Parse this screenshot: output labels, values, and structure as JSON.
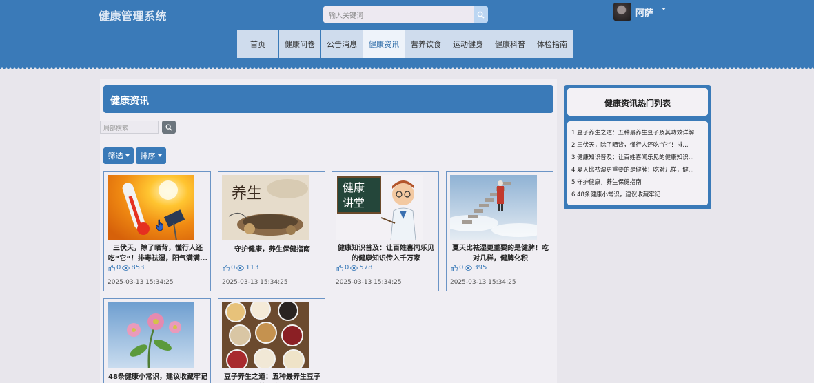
{
  "header": {
    "site_title": "健康管理系统",
    "search_placeholder": "输入关键词",
    "search_icon": "search-icon",
    "user_name": "阿萨"
  },
  "nav": [
    {
      "label": "首页",
      "active": false
    },
    {
      "label": "健康问卷",
      "active": false
    },
    {
      "label": "公告消息",
      "active": false
    },
    {
      "label": "健康资讯",
      "active": true
    },
    {
      "label": "营养饮食",
      "active": false
    },
    {
      "label": "运动健身",
      "active": false
    },
    {
      "label": "健康科普",
      "active": false
    },
    {
      "label": "体检指南",
      "active": false
    }
  ],
  "main": {
    "title": "健康资讯",
    "local_search_placeholder": "局部搜索",
    "filter_label": "筛选",
    "sort_label": "排序",
    "cards": [
      {
        "title": "三伏天，除了晒背，懂行人还吃“它”！排毒祛湿，阳气满满...",
        "likes": "0",
        "views": "853",
        "date": "2025-03-13 15:34:25",
        "image": "thermometer-sun"
      },
      {
        "title": "守护健康，养生保健指南",
        "likes": "0",
        "views": "113",
        "date": "2025-03-13 15:34:25",
        "image": "yangsheng-herbs"
      },
      {
        "title": "健康知识普及：让百姓喜闻乐见的健康知识传入千万家",
        "likes": "0",
        "views": "578",
        "date": "2025-03-13 15:34:25",
        "image": "health-lecture"
      },
      {
        "title": "夏天比祛湿更重要的是健脾！吃对几样，健脾化积",
        "likes": "0",
        "views": "395",
        "date": "2025-03-13 15:34:25",
        "image": "stairs-sky"
      },
      {
        "title": "48条健康小常识，建议收藏牢记",
        "likes": "",
        "views": "",
        "date": "",
        "image": "flower-sky"
      },
      {
        "title": "豆子养生之道：五种最养生豆子及其功效详解",
        "likes": "",
        "views": "",
        "date": "",
        "image": "beans-bowls"
      }
    ],
    "chalkboard_text": [
      "健康",
      "讲堂"
    ],
    "yangsheng_text": "养生"
  },
  "sidebar": {
    "title": "健康资讯热门列表",
    "items": [
      "1  豆子养生之道：五种最养生豆子及其功效详解",
      "2  三伏天，除了晒背，懂行人还吃“它”！排...",
      "3  健康知识普及：让百姓喜闻乐见的健康知识...",
      "4  夏天比祛湿更重要的是健脾！吃对几样，健...",
      "5  守护健康，养生保健指南",
      "6  48条健康小常识，建议收藏牢记"
    ]
  },
  "colors": {
    "primary": "#3a7ab8",
    "nav_bg": "#cfdced",
    "page_bg": "#e8e6ec"
  }
}
